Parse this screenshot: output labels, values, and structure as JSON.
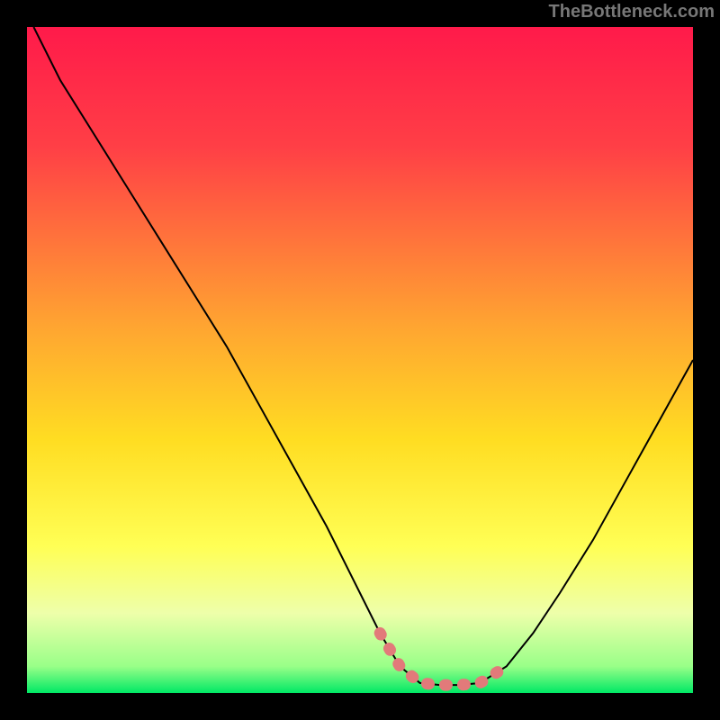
{
  "watermark": "TheBottleneck.com",
  "chart_data": {
    "type": "line",
    "title": "",
    "xlabel": "",
    "ylabel": "",
    "xlim": [
      0,
      100
    ],
    "ylim": [
      0,
      100
    ],
    "gradient_stops": [
      {
        "offset": 0,
        "color": "#ff1a4a"
      },
      {
        "offset": 18,
        "color": "#ff3f46"
      },
      {
        "offset": 45,
        "color": "#ffa531"
      },
      {
        "offset": 62,
        "color": "#ffdd22"
      },
      {
        "offset": 78,
        "color": "#ffff55"
      },
      {
        "offset": 88,
        "color": "#eeffaa"
      },
      {
        "offset": 96,
        "color": "#99ff88"
      },
      {
        "offset": 100,
        "color": "#00e865"
      }
    ],
    "series": [
      {
        "name": "bottleneck-curve",
        "color": "#000000",
        "x": [
          1,
          5,
          10,
          15,
          20,
          25,
          30,
          35,
          40,
          45,
          50,
          53,
          56,
          59,
          62,
          65,
          68,
          72,
          76,
          80,
          85,
          90,
          95,
          100
        ],
        "y": [
          100,
          92,
          84,
          76,
          68,
          60,
          52,
          43,
          34,
          25,
          15,
          9,
          4,
          1.5,
          1.2,
          1.2,
          1.5,
          4,
          9,
          15,
          23,
          32,
          41,
          50
        ]
      }
    ],
    "highlight_segment": {
      "name": "optimal-range",
      "color": "#e27a7a",
      "x": [
        53,
        56,
        59,
        62,
        65,
        68,
        72
      ],
      "y": [
        9,
        4,
        1.5,
        1.2,
        1.2,
        1.5,
        4
      ]
    }
  }
}
